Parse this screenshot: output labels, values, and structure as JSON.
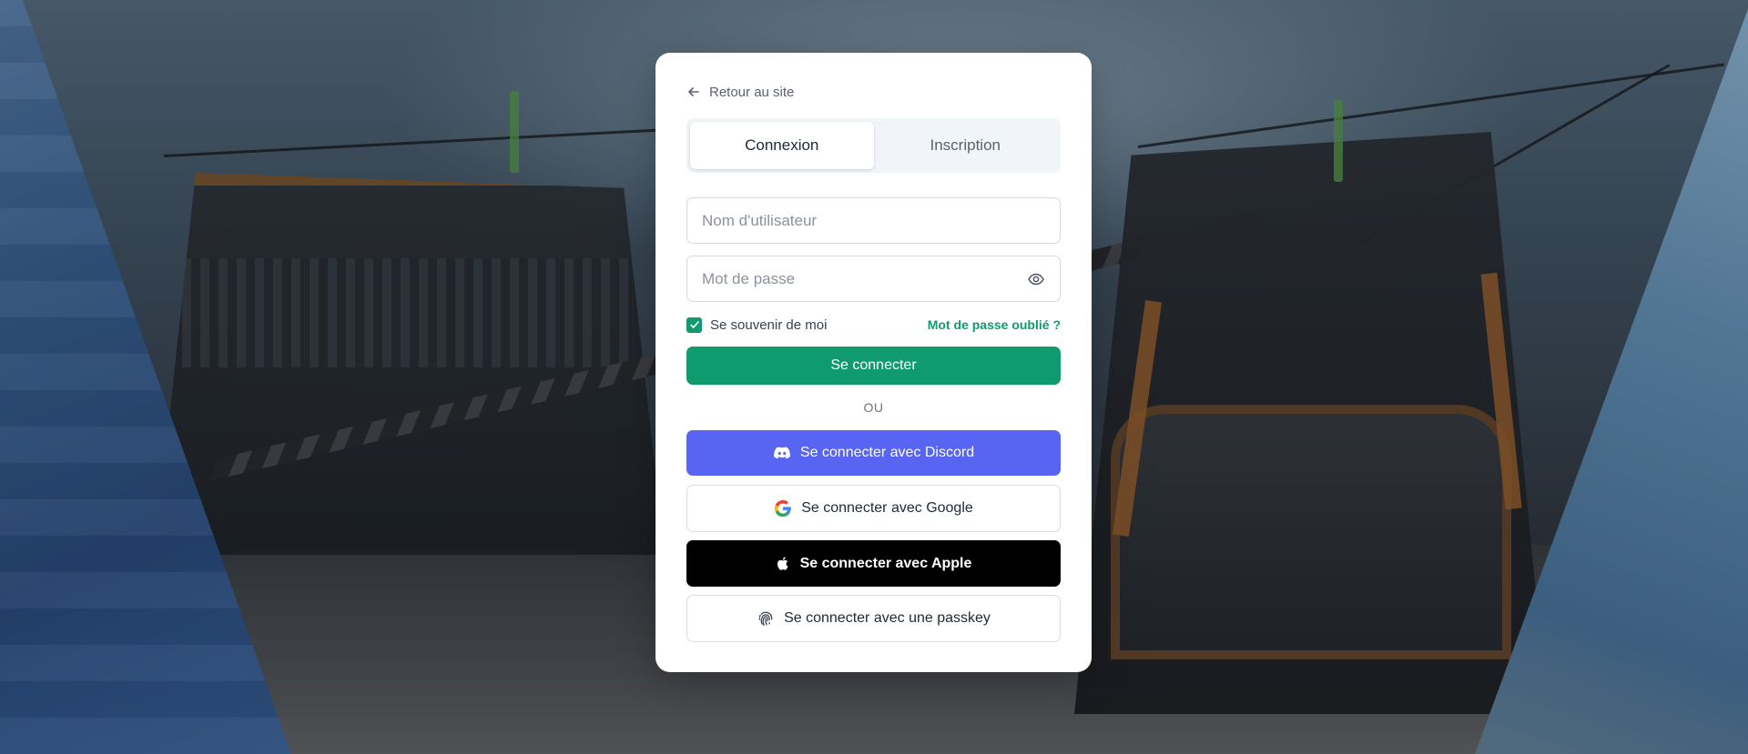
{
  "back_link": {
    "label": "Retour au site",
    "icon": "arrow-left-icon"
  },
  "tabs": [
    {
      "label": "Connexion",
      "active": true
    },
    {
      "label": "Inscription",
      "active": false
    }
  ],
  "form": {
    "username": {
      "placeholder": "Nom d'utilisateur",
      "value": ""
    },
    "password": {
      "placeholder": "Mot de passe",
      "value": "",
      "toggle_icon": "eye-icon"
    },
    "remember_me": {
      "label": "Se souvenir de moi",
      "checked": true
    },
    "forgot_password": "Mot de passe oublié ?",
    "submit_label": "Se connecter"
  },
  "divider_label": "OU",
  "social": {
    "discord": {
      "label": "Se connecter avec Discord",
      "icon": "discord-icon",
      "color": "#5865f2"
    },
    "google": {
      "label": "Se connecter avec Google",
      "icon": "google-icon"
    },
    "apple": {
      "label": "Se connecter avec Apple",
      "icon": "apple-icon",
      "color": "#000000"
    },
    "passkey": {
      "label": "Se connecter avec une passkey",
      "icon": "fingerprint-icon"
    }
  },
  "colors": {
    "accent": "#0f9b6e",
    "discord": "#5865f2"
  }
}
